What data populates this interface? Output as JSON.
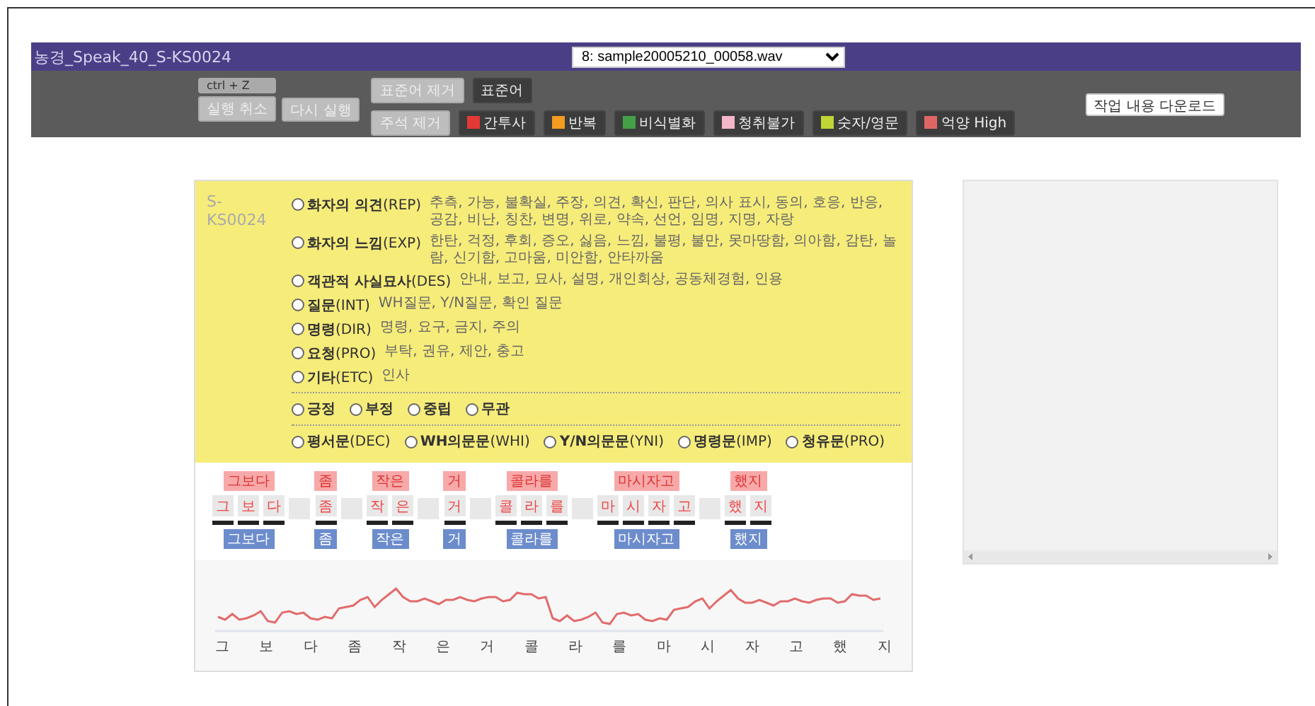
{
  "header": {
    "title": "농경_Speak_40_S-KS0024",
    "file_select": "8: sample20005210_00058.wav"
  },
  "toolbar": {
    "undo_shortcut": "ctrl + Z",
    "undo": "실행 취소",
    "redo": "다시 실행",
    "remove_standard": "표준어 제거",
    "standard": "표준어",
    "remove_notes": "주석 제거",
    "tags": [
      {
        "label": "간투사",
        "color": "#e53935"
      },
      {
        "label": "반복",
        "color": "#f39c1f"
      },
      {
        "label": "비식별화",
        "color": "#43a047"
      },
      {
        "label": "청취불가",
        "color": "#f4b6c8"
      },
      {
        "label": "숫자/영문",
        "color": "#c0d436"
      },
      {
        "label": "억양 High",
        "color": "#e06666"
      }
    ],
    "download": "작업 내용 다운로드"
  },
  "card": {
    "id": "S-KS0024",
    "speech_acts": [
      {
        "label": "**화자의 의견**(REP)",
        "description": "추측, 가능, 불확실, 주장, 의견, 확신, 판단, 의사 표시, 동의, 호응, 반응, 공감, 비난, 칭찬, 변명, 위로, 약속, 선언, 임명, 지명, 자랑",
        "selected": false
      },
      {
        "label": "**화자의 느낌**(EXP)",
        "description": "한탄, 걱정, 후회, 증오, 싫음, 느낌, 불평, 불만, 못마땅함, 의아함, 감탄, 놀람, 신기함, 고마움, 미안함, 안타까움",
        "selected": false
      },
      {
        "label": "**객관적 사실묘사**(DES)",
        "description": "안내, 보고, 묘사, 설명, 개인회상, 공동체경험, 인용",
        "selected": false
      },
      {
        "label": "**질문**(INT)",
        "description": "WH질문, Y/N질문, 확인 질문",
        "selected": false
      },
      {
        "label": "**명령**(DIR)",
        "description": "명령, 요구, 금지, 주의",
        "selected": false
      },
      {
        "label": "**요청**(PRO)",
        "description": "부탁, 권유, 제안, 충고",
        "selected": false
      },
      {
        "label": "**기타**(ETC)",
        "description": "인사",
        "selected": false
      }
    ],
    "sentiments": [
      {
        "label": "**긍정**",
        "selected": false
      },
      {
        "label": "**부정**",
        "selected": false
      },
      {
        "label": "**중립**",
        "selected": false
      },
      {
        "label": "**무관**",
        "selected": false
      }
    ],
    "sentence_types": [
      {
        "label": "**평서문**(DEC)",
        "selected": false
      },
      {
        "label": "**WH의문문**(WHI)",
        "selected": false
      },
      {
        "label": "**Y/N의문문**(YNI)",
        "selected": false
      },
      {
        "label": "**명령문**(IMP)",
        "selected": false
      },
      {
        "label": "**청유문**(PRO)",
        "selected": false
      }
    ],
    "words": [
      {
        "text": "그보다",
        "syllables": [
          "그",
          "보",
          "다"
        ],
        "standard": "그보다"
      },
      {
        "text": "좀",
        "syllables": [
          "좀"
        ],
        "standard": "좀"
      },
      {
        "text": "작은",
        "syllables": [
          "작",
          "은"
        ],
        "standard": "작은"
      },
      {
        "text": "거",
        "syllables": [
          "거"
        ],
        "standard": "거"
      },
      {
        "text": "콜라를",
        "syllables": [
          "콜",
          "라",
          "를"
        ],
        "standard": "콜라를"
      },
      {
        "text": "마시자고",
        "syllables": [
          "마",
          "시",
          "자",
          "고"
        ],
        "standard": "마시자고"
      },
      {
        "text": "했지",
        "syllables": [
          "했",
          "지"
        ],
        "standard": "했지"
      }
    ],
    "pitch_labels": [
      "그",
      "보",
      "다",
      "좀",
      "작",
      "은",
      "거",
      "콜",
      "라",
      "를",
      "마",
      "시",
      "자",
      "고",
      "했",
      "지"
    ]
  }
}
